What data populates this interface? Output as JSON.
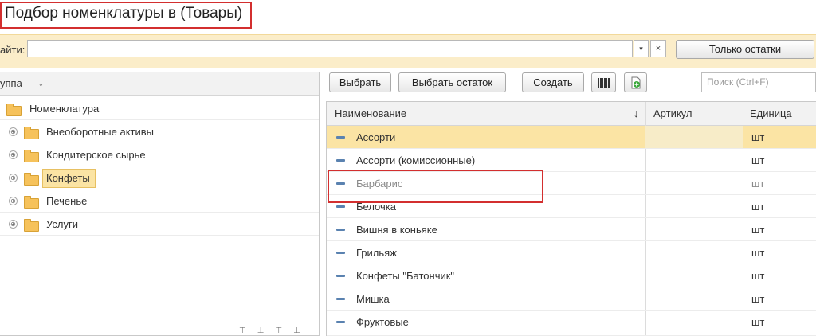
{
  "window": {
    "title": "Подбор номенклатуры в (Товары)"
  },
  "search_bar": {
    "label": "айти:",
    "value": "",
    "clear_symbol": "×",
    "dropdown_symbol": "▾",
    "only_stock_label": "Только остатки"
  },
  "tree": {
    "header": "уппа",
    "sort_symbol": "↓",
    "root": "Номенклатура",
    "items": [
      {
        "label": "Внеоборотные активы"
      },
      {
        "label": "Кондитерское сырье"
      },
      {
        "label": "Конфеты",
        "selected": true
      },
      {
        "label": "Печенье"
      },
      {
        "label": "Услуги"
      }
    ],
    "expand_symbol": "⊕"
  },
  "toolbar": {
    "select_label": "Выбрать",
    "select_rest_label": "Выбрать остаток",
    "create_label": "Создать",
    "barcode_icon": "barcode-icon",
    "add_icon": "add-document-icon",
    "search_placeholder": "Поиск (Ctrl+F)"
  },
  "table": {
    "columns": [
      "Наименование",
      "Артикул",
      "Единица"
    ],
    "sort_symbol": "↓",
    "rows": [
      {
        "name": "Ассорти",
        "article": "",
        "unit": "шт",
        "selected": true
      },
      {
        "name": "Ассорти (комиссионные)",
        "article": "",
        "unit": "шт"
      },
      {
        "name": "Барбарис",
        "article": "",
        "unit": "шт",
        "muted": true
      },
      {
        "name": "Белочка",
        "article": "",
        "unit": "шт"
      },
      {
        "name": "Вишня в коньяке",
        "article": "",
        "unit": "шт"
      },
      {
        "name": "Грильяж",
        "article": "",
        "unit": "шт"
      },
      {
        "name": "Конфеты \"Батончик\"",
        "article": "",
        "unit": "шт"
      },
      {
        "name": "Мишка",
        "article": "",
        "unit": "шт"
      },
      {
        "name": "Фруктовые",
        "article": "",
        "unit": "шт"
      }
    ]
  },
  "colors": {
    "accent_band": "#fbedc9",
    "selection": "#fbe4a4",
    "annotation_red": "#d32f2f",
    "item_icon": "#5a82b0",
    "folder": "#f6c25b"
  }
}
